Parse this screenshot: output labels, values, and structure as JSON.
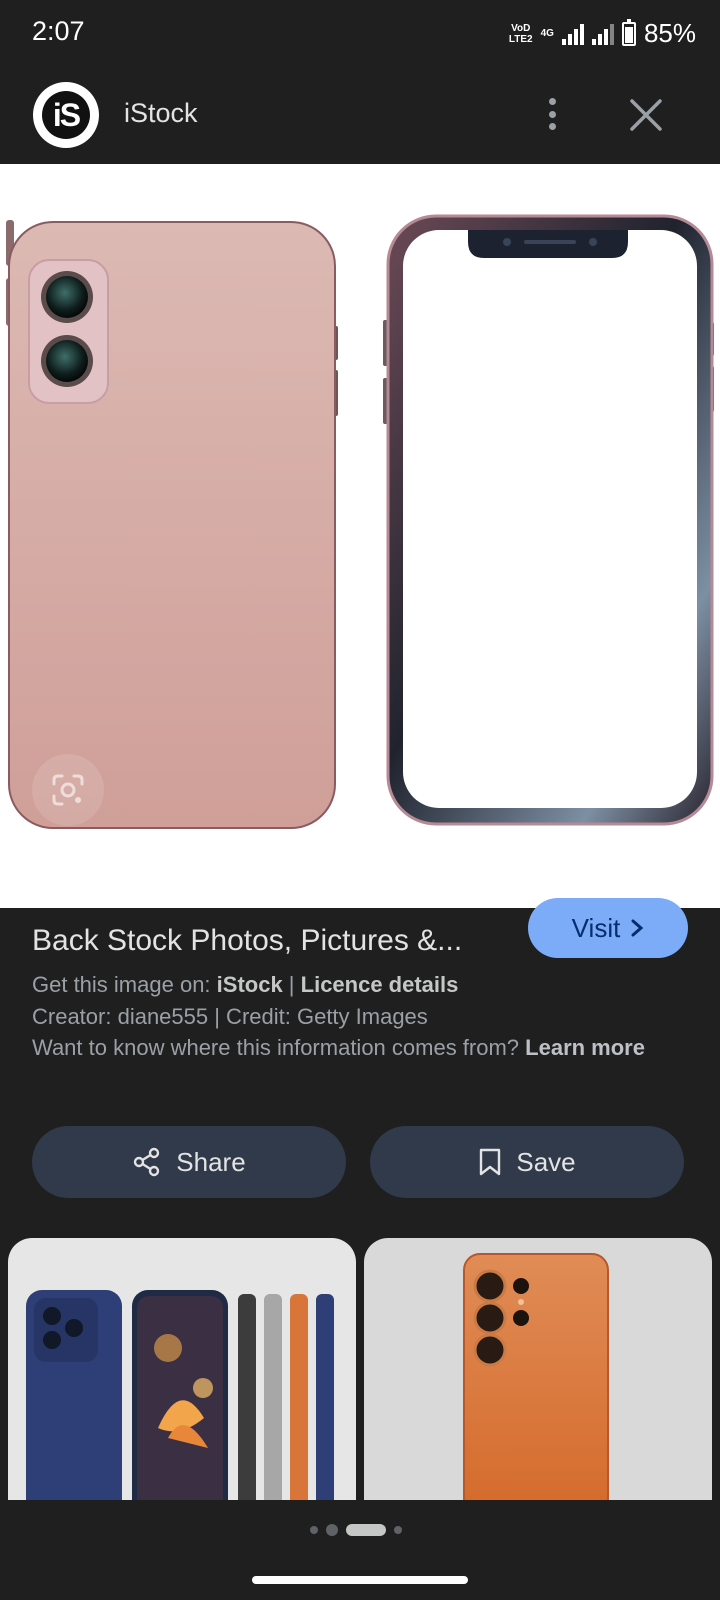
{
  "status_bar": {
    "time": "2:07",
    "network_label_top": "VoD",
    "network_label_bottom": "LTE2",
    "network_type": "4G",
    "battery": "85%",
    "battery_level": 0.85
  },
  "header": {
    "logo_text": "iS",
    "site_name": "iStock"
  },
  "main_image": {
    "alt_icon": "google-lens-icon"
  },
  "info": {
    "visit_label": "Visit",
    "title": "Back Stock Photos, Pictures &...",
    "get_image_prefix": "Get this image on: ",
    "get_image_source": "iStock",
    "separator": " | ",
    "licence": "Licence details",
    "creator_credit": "Creator: diane555 | Credit: Getty Images",
    "learn_prefix": "Want to know where this information comes from? ",
    "learn_more": "Learn more"
  },
  "actions": {
    "share_label": "Share",
    "save_label": "Save"
  },
  "colors": {
    "background": "#1f1f1f",
    "accent": "#7cacf8",
    "button_bg": "#303a4a"
  }
}
